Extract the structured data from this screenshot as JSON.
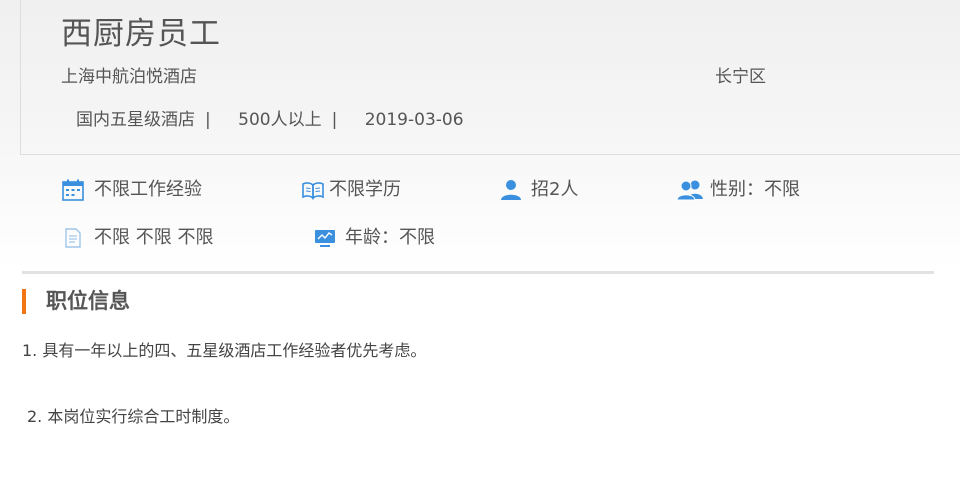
{
  "job": {
    "title": "西厨房员工",
    "company": "上海中航泊悦酒店",
    "district": "长宁区",
    "company_type": "国内五星级酒店",
    "company_size": "500人以上",
    "date": "2019-03-06",
    "separator": "|"
  },
  "requirements": {
    "experience": "不限工作经验",
    "education": "不限学历",
    "headcount": "招2人",
    "gender": "性别：不限",
    "other": "不限 不限 不限",
    "age": "年龄：不限"
  },
  "section": {
    "title": "职位信息"
  },
  "description": [
    "1. 具有一年以上的四、五星级酒店工作经验者优先考虑。",
    "2. 本岗位实行综合工时制度。"
  ],
  "colors": {
    "accent": "#f27516",
    "icon_blue": "#3a8fdf",
    "text": "#555555"
  },
  "icons": {
    "experience": "calendar-icon",
    "education": "book-icon",
    "headcount": "person-icon",
    "gender": "people-icon",
    "other": "document-icon",
    "age": "monitor-icon"
  }
}
